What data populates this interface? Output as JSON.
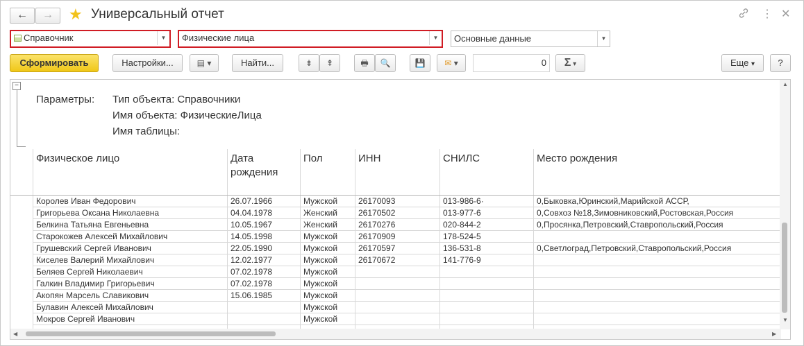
{
  "window": {
    "title": "Универсальный отчет",
    "back_icon": "←",
    "forward_icon": "→",
    "link_icon": "🔗",
    "menu_icon": "⋮",
    "close_icon": "✕"
  },
  "selectors": {
    "object_type": "Справочник",
    "object_name": "Физические лица",
    "table_name": "Основные данные"
  },
  "toolbar": {
    "generate_label": "Сформировать",
    "settings_label": "Настройки...",
    "find_label": "Найти...",
    "amount_value": "0",
    "sum_label": "Σ",
    "more_label": "Еще",
    "help_label": "?"
  },
  "report": {
    "params_label": "Параметры:",
    "param_lines": [
      "Тип объекта: Справочники",
      "Имя объекта: ФизическиеЛица",
      "Имя таблицы:"
    ],
    "columns": [
      "Физическое лицо",
      "Дата рождения",
      "Пол",
      "ИНН",
      "СНИЛС",
      "Место рождения"
    ],
    "rows": [
      [
        "Королев Иван Федорович",
        "26.07.1966",
        "Мужской",
        "26170093",
        "013-986-6·",
        "0,Быковка,Юринский,Марийской АССР,"
      ],
      [
        "Григорьева Оксана Николаевна",
        "04.04.1978",
        "Женский",
        "26170502",
        "013-977-6",
        "0,Совхоз №18,Зимовниковский,Ростовская,Россия"
      ],
      [
        "Белкина Татьяна Евгеньевна",
        "10.05.1967",
        "Женский",
        "26170276",
        "020-844-2",
        "0,Просянка,Петровский,Ставропольский,Россия"
      ],
      [
        "Старокожев Алексей Михайлович",
        "14.05.1998",
        "Мужской",
        "26170909",
        "178-524-5",
        ""
      ],
      [
        "Грушевский Сергей Иванович",
        "22.05.1990",
        "Мужской",
        "26170597",
        "136-531-8",
        "0,Светлоград,Петровский,Ставропольский,Россия"
      ],
      [
        "Киселев Валерий Михайлович",
        "12.02.1977",
        "Мужской",
        "26170672",
        "141-776-9",
        ""
      ],
      [
        "Беляев Сергей Николаевич",
        "07.02.1978",
        "Мужской",
        "",
        "",
        ""
      ],
      [
        "Галкин Владимир Григорьевич",
        "07.02.1978",
        "Мужской",
        "",
        "",
        ""
      ],
      [
        "Акопян Марсель Славикович",
        "15.06.1985",
        "Мужской",
        "",
        "",
        ""
      ],
      [
        "Булавин Алексей Михайлович",
        "",
        "Мужской",
        "",
        "",
        ""
      ],
      [
        "Мокров Сергей Иванович",
        "",
        "Мужской",
        "",
        "",
        ""
      ]
    ]
  }
}
